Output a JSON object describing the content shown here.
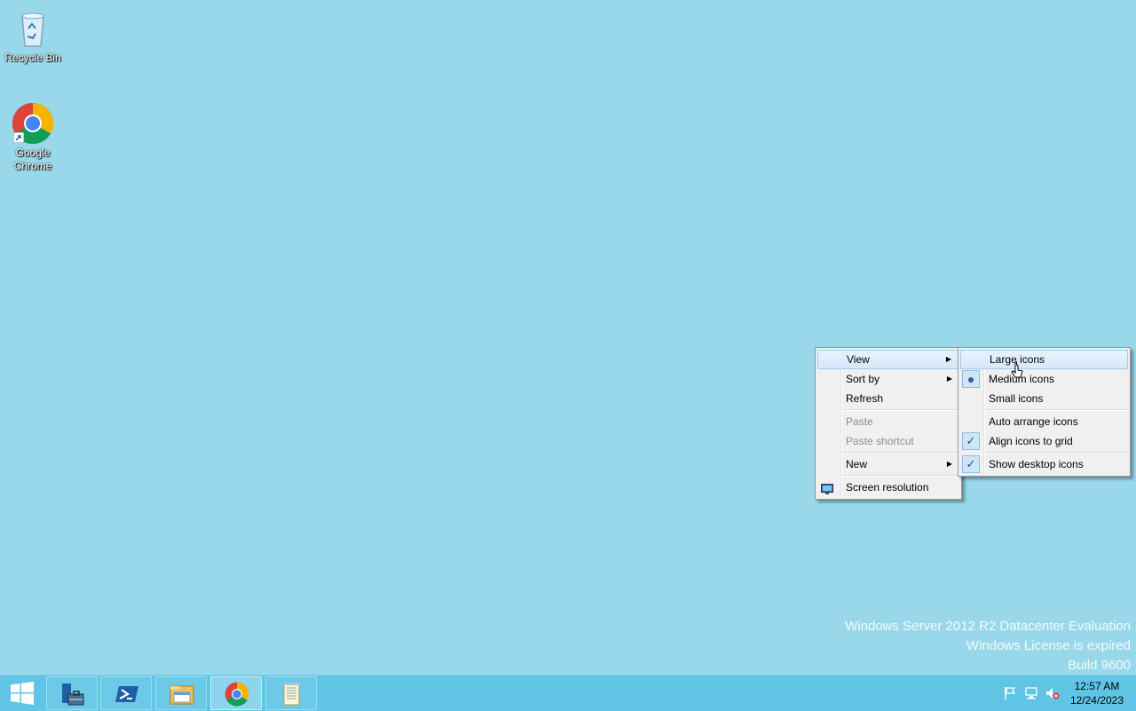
{
  "desktop": {
    "icons": [
      {
        "label": "Recycle Bin"
      },
      {
        "label": "Google\nChrome"
      }
    ],
    "watermark": {
      "line1": "Windows Server 2012 R2 Datacenter Evaluation",
      "line2": "Windows License is expired",
      "line3": "Build 9600"
    },
    "background_color": "#99d8ea"
  },
  "context_menu": {
    "items": [
      {
        "label": "View",
        "has_submenu": true,
        "highlighted": true
      },
      {
        "label": "Sort by",
        "has_submenu": true
      },
      {
        "label": "Refresh"
      },
      {
        "label": "Paste",
        "disabled": true
      },
      {
        "label": "Paste shortcut",
        "disabled": true
      },
      {
        "label": "New",
        "has_submenu": true
      },
      {
        "label": "Screen resolution",
        "icon": "display-icon"
      }
    ]
  },
  "view_submenu": {
    "items": [
      {
        "label": "Large icons",
        "highlighted": true
      },
      {
        "label": "Medium icons",
        "selected": true
      },
      {
        "label": "Small icons"
      },
      {
        "label": "Auto arrange icons"
      },
      {
        "label": "Align icons to grid",
        "checked": true
      },
      {
        "label": "Show desktop icons",
        "checked": true
      }
    ]
  },
  "taskbar": {
    "buttons": [
      {
        "name": "start-icon"
      },
      {
        "name": "server-manager-icon"
      },
      {
        "name": "powershell-icon"
      },
      {
        "name": "file-explorer-icon"
      },
      {
        "name": "chrome-icon",
        "active": true
      },
      {
        "name": "notepad-icon"
      }
    ],
    "tray": [
      "action-center-flag-icon",
      "network-icon",
      "volume-muted-icon"
    ],
    "clock": {
      "time": "12:57 AM",
      "date": "12/24/2023"
    },
    "color": "#60c5e5"
  }
}
